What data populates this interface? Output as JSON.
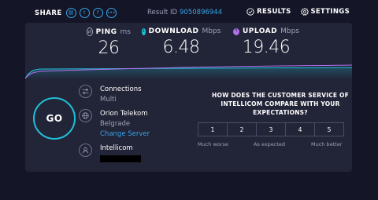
{
  "header": {
    "share_label": "SHARE",
    "share_icons": [
      "link-icon",
      "twitter-icon",
      "facebook-icon",
      "more-icon"
    ],
    "result_label": "Result ID",
    "result_id": "9050896944",
    "results_label": "RESULTS",
    "settings_label": "SETTINGS"
  },
  "metrics": {
    "ping": {
      "name": "PING",
      "unit": "ms",
      "value": "26",
      "color": "#9ea0b8"
    },
    "download": {
      "name": "DOWNLOAD",
      "unit": "Mbps",
      "value": "6.48",
      "color": "#1fc0d8"
    },
    "upload": {
      "name": "UPLOAD",
      "unit": "Mbps",
      "value": "19.46",
      "color": "#b46ff0"
    }
  },
  "go_label": "GO",
  "connections": {
    "label": "Connections",
    "value": "Multi"
  },
  "isp": {
    "name": "Orion Telekom",
    "location": "Belgrade",
    "change_label": "Change Server"
  },
  "host": {
    "name": "Intellicom"
  },
  "survey": {
    "question": "HOW DOES THE CUSTOMER SERVICE OF INTELLICOM COMPARE WITH YOUR EXPECTATIONS?",
    "options": [
      "1",
      "2",
      "3",
      "4",
      "5"
    ],
    "low_label": "Much worse",
    "mid_label": "As expected",
    "high_label": "Much better"
  },
  "colors": {
    "accent": "#38a5e8",
    "download": "#1fc0d8",
    "upload": "#b46ff0",
    "panel": "#222437",
    "background": "#141526"
  }
}
